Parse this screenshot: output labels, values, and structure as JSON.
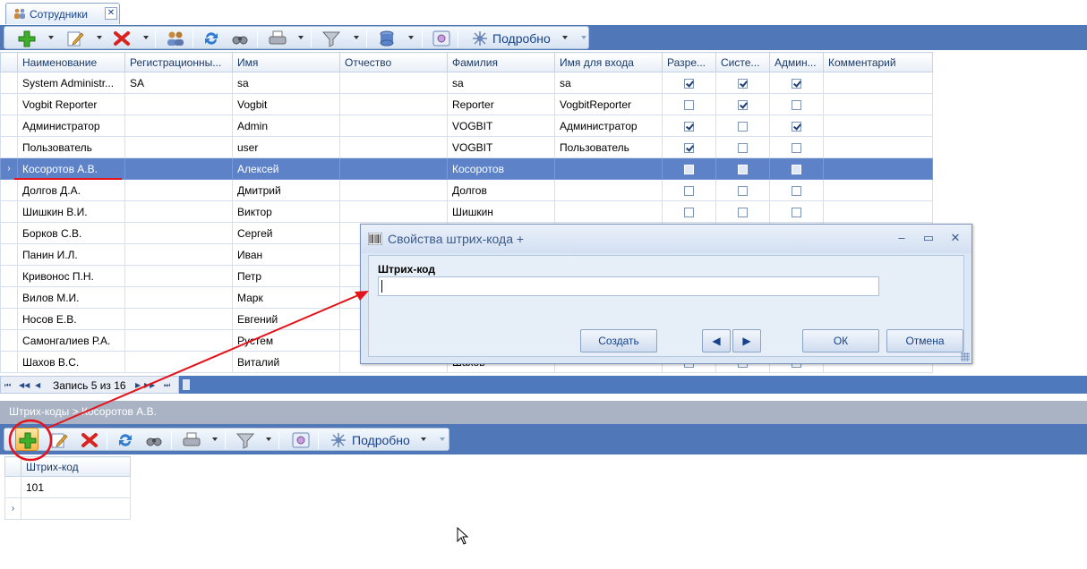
{
  "tab": {
    "label": "Сотрудники",
    "close": "✕"
  },
  "toolbar": {
    "details_label": "Подробно",
    "icons": [
      "add-icon",
      "edit-icon",
      "delete-icon",
      "users-icon",
      "refresh-icon",
      "binoculars-icon",
      "print-icon",
      "filter-icon",
      "database-icon",
      "settings-icon",
      "details-icon"
    ]
  },
  "employees": {
    "columns": [
      "Наименование",
      "Регистрационны...",
      "Имя",
      "Отчество",
      "Фамилия",
      "Имя для входа",
      "Разре...",
      "Систе...",
      "Админ...",
      "Комментарий"
    ],
    "rows": [
      {
        "name": "System Administr...",
        "reg": "SA",
        "first": "sa",
        "middle": "",
        "last": "sa",
        "login": "sa",
        "c1": true,
        "c2": true,
        "c3": true,
        "comment": ""
      },
      {
        "name": "Vogbit Reporter",
        "reg": "",
        "first": "Vogbit",
        "middle": "",
        "last": "Reporter",
        "login": "VogbitReporter",
        "c1": false,
        "c2": true,
        "c3": false,
        "comment": ""
      },
      {
        "name": "Администратор",
        "reg": "",
        "first": "Admin",
        "middle": "",
        "last": "VOGBIT",
        "login": "Администратор",
        "c1": true,
        "c2": false,
        "c3": true,
        "comment": ""
      },
      {
        "name": "Пользователь",
        "reg": "",
        "first": "user",
        "middle": "",
        "last": "VOGBIT",
        "login": "Пользователь",
        "c1": true,
        "c2": false,
        "c3": false,
        "comment": ""
      },
      {
        "name": "Косоротов А.В.",
        "reg": "",
        "first": "Алексей",
        "middle": "",
        "last": "Косоротов",
        "login": "",
        "c1": false,
        "c2": false,
        "c3": false,
        "comment": "",
        "selected": true
      },
      {
        "name": "Долгов Д.А.",
        "reg": "",
        "first": "Дмитрий",
        "middle": "",
        "last": "Долгов",
        "login": "",
        "c1": false,
        "c2": false,
        "c3": false,
        "comment": ""
      },
      {
        "name": "Шишкин В.И.",
        "reg": "",
        "first": "Виктор",
        "middle": "",
        "last": "Шишкин",
        "login": "",
        "c1": false,
        "c2": false,
        "c3": false,
        "comment": ""
      },
      {
        "name": "Борков С.В.",
        "reg": "",
        "first": "Сергей",
        "middle": "",
        "last": "",
        "login": "",
        "c1": false,
        "c2": false,
        "c3": false,
        "comment": ""
      },
      {
        "name": "Панин И.Л.",
        "reg": "",
        "first": "Иван",
        "middle": "",
        "last": "",
        "login": "",
        "c1": false,
        "c2": false,
        "c3": false,
        "comment": ""
      },
      {
        "name": "Кривонос П.Н.",
        "reg": "",
        "first": "Петр",
        "middle": "",
        "last": "",
        "login": "",
        "c1": false,
        "c2": false,
        "c3": false,
        "comment": ""
      },
      {
        "name": "Вилов М.И.",
        "reg": "",
        "first": "Марк",
        "middle": "",
        "last": "",
        "login": "",
        "c1": false,
        "c2": false,
        "c3": false,
        "comment": ""
      },
      {
        "name": "Носов Е.В.",
        "reg": "",
        "first": "Евгений",
        "middle": "",
        "last": "",
        "login": "",
        "c1": false,
        "c2": false,
        "c3": false,
        "comment": ""
      },
      {
        "name": "Самонгалиев Р.А.",
        "reg": "",
        "first": "Рустем",
        "middle": "",
        "last": "",
        "login": "",
        "c1": false,
        "c2": false,
        "c3": false,
        "comment": ""
      },
      {
        "name": "Шахов В.С.",
        "reg": "",
        "first": "Виталий",
        "middle": "",
        "last": "Шахов",
        "login": "",
        "c1": false,
        "c2": false,
        "c3": false,
        "comment": ""
      }
    ],
    "record_info": "Запись 5 из 16"
  },
  "barcodes": {
    "breadcrumb": "Штрих-коды > Косоротов А.В.",
    "column": "Штрих-код",
    "rows": [
      "101"
    ]
  },
  "dialog": {
    "title": "Свойства штрих-кода +",
    "field_label": "Штрих-код",
    "field_value": "",
    "create_label": "Создать",
    "ok_label": "ОК",
    "cancel_label": "Отмена",
    "minimize": "‒",
    "maximize": "▭",
    "close": "✕",
    "prev": "◀",
    "next": "▶"
  },
  "colors": {
    "accent": "#5077b8",
    "selected_row": "#5e82c7",
    "annotation": "#e3141b"
  }
}
